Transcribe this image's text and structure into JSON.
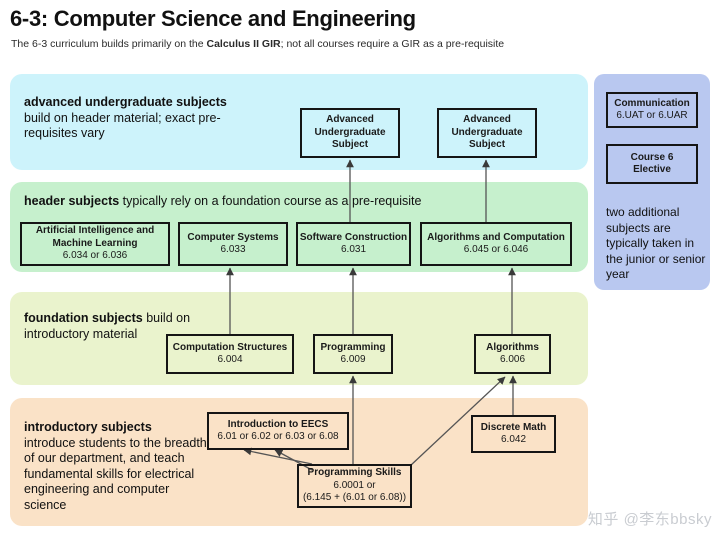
{
  "header": {
    "title": "6-3: Computer Science and Engineering",
    "subtitle_pre": "The 6-3 curriculum builds primarily on the ",
    "subtitle_bold": "Calculus II GIR",
    "subtitle_post": "; not all courses require a GIR as a pre-requisite"
  },
  "bands": {
    "advanced": {
      "label_bold": "advanced undergraduate subjects",
      "label_rest": "build on header material; exact pre-requisites vary",
      "color": "#cdf3fb"
    },
    "header_subjects": {
      "label_bold": "header subjects",
      "label_rest": "typically rely on a foundation course as a pre-requisite",
      "color": "#c6f0cd"
    },
    "foundation": {
      "label_bold": "foundation subjects",
      "label_rest": "build on introductory material",
      "color": "#eaf3cd"
    },
    "introductory": {
      "label_bold": "introductory subjects",
      "label_rest": "introduce students to the breadth of our department, and teach fundamental skills for electrical engineering and computer science",
      "color": "#fae2c7"
    },
    "sidebar": {
      "color": "#b9c8f0"
    }
  },
  "nodes": {
    "advanced": [
      {
        "title": "Advanced Undergraduate Subject",
        "code": ""
      },
      {
        "title": "Advanced Undergraduate Subject",
        "code": ""
      }
    ],
    "header_subjects": [
      {
        "title": "Artificial Intelligence and Machine Learning",
        "code": "6.034 or 6.036"
      },
      {
        "title": "Computer Systems",
        "code": "6.033"
      },
      {
        "title": "Software Construction",
        "code": "6.031"
      },
      {
        "title": "Algorithms and Computation",
        "code": "6.045 or 6.046"
      }
    ],
    "foundation": [
      {
        "title": "Computation Structures",
        "code": "6.004"
      },
      {
        "title": "Programming",
        "code": "6.009"
      },
      {
        "title": "Algorithms",
        "code": "6.006"
      }
    ],
    "introductory": [
      {
        "title": "Introduction to EECS",
        "code": "6.01 or 6.02 or 6.03 or 6.08"
      },
      {
        "title": "Discrete Math",
        "code": "6.042"
      },
      {
        "title": "Programming Skills",
        "code": "6.0001 or",
        "code2": "(6.145 + (6.01 or 6.08))"
      }
    ],
    "sidebar": [
      {
        "title": "Communication",
        "code": "6.UAT or 6.UAR"
      },
      {
        "title": "Course 6",
        "title2": "Elective",
        "code": ""
      }
    ]
  },
  "sidebar_note": "two additional subjects are typically taken in the junior or senior year",
  "watermark": "知乎 @李东bbsky"
}
